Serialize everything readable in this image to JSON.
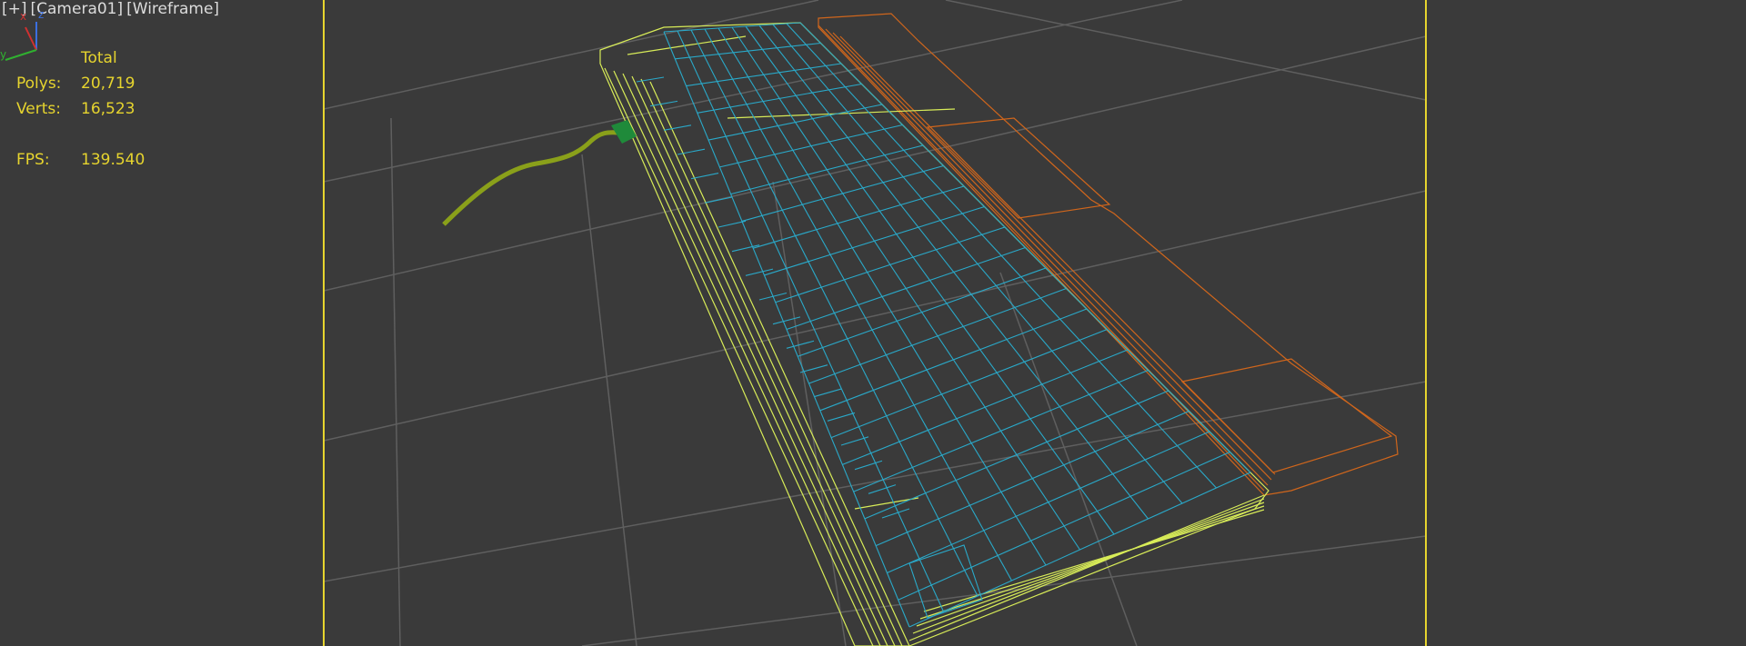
{
  "viewport": {
    "labels": [
      "[+]",
      "[Camera01]",
      "[Wireframe]"
    ],
    "stats": {
      "header": "Total",
      "polys_label": "Polys:",
      "polys_value": "20,719",
      "verts_label": "Verts:",
      "verts_value": "16,523",
      "fps_label": "FPS:",
      "fps_value": "139.540"
    },
    "axis_labels": {
      "x": "x",
      "y": "y",
      "z": "z"
    },
    "colors": {
      "background": "#3a3a3a",
      "grid": "#6b6b6b",
      "safe_frame": "#e6d42e",
      "keyboard_body": "#d8ec58",
      "keycaps": "#2aa9c9",
      "wrist_rest": "#d0661c",
      "cable": "#8aa01a",
      "plug": "#1f8a3a",
      "stats_text": "#e6d42e"
    },
    "icons": [
      "axis-gizmo-icon"
    ]
  }
}
